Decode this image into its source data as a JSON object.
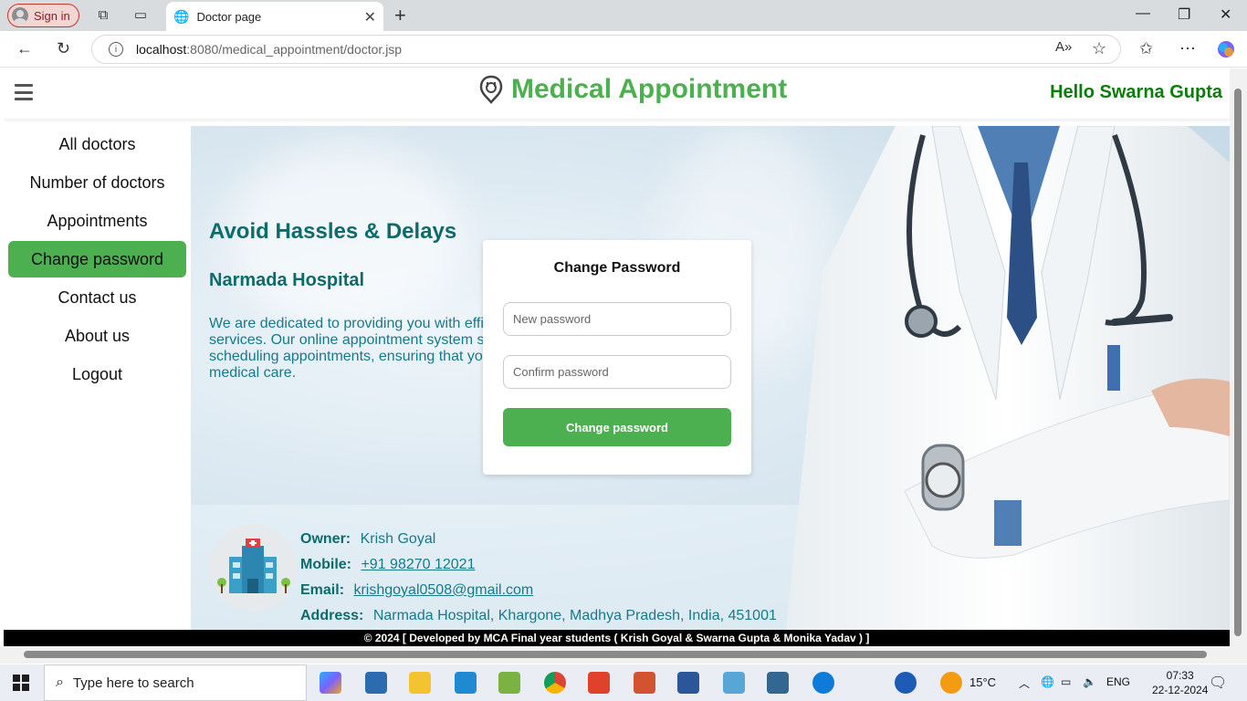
{
  "browser": {
    "signin_label": "Sign in",
    "tab_title": "Doctor page",
    "url_host": "localhost",
    "url_path": ":8080/medical_appointment/doctor.jsp"
  },
  "header": {
    "title": "Medical Appointment",
    "greeting": "Hello Swarna Gupta"
  },
  "sidebar": {
    "items": [
      {
        "label": "All doctors"
      },
      {
        "label": "Number of doctors"
      },
      {
        "label": "Appointments"
      },
      {
        "label": "Change password",
        "active": true
      },
      {
        "label": "Contact us"
      },
      {
        "label": "About us"
      },
      {
        "label": "Logout"
      }
    ]
  },
  "hero": {
    "heading": "Avoid Hassles & Delays",
    "hospital": "Narmada Hospital",
    "description_lines": [
      "We are dedicated to providing you with effi",
      "services. Our online appointment system s",
      "scheduling appointments, ensuring that yo",
      "medical care."
    ]
  },
  "change_password": {
    "title": "Change Password",
    "new_placeholder": "New password",
    "confirm_placeholder": "Confirm password",
    "submit_label": "Change password"
  },
  "contact": {
    "owner_label": "Owner:",
    "owner_value": "Krish Goyal",
    "mobile_label": "Mobile:",
    "mobile_value": "+91 98270 12021",
    "email_label": "Email:",
    "email_value": "krishgoyal0508@gmail.com",
    "address_label": "Address:",
    "address_value": "Narmada Hospital, Khargone, Madhya Pradesh, India, 451001"
  },
  "footer": {
    "copyright": "© 2024 [ Developed by MCA Final year students ( Krish Goyal & Swarna Gupta & Monika Yadav ) ]"
  },
  "taskbar": {
    "search_placeholder": "Type here to search",
    "weather": "15°C",
    "language": "ENG",
    "time": "07:33",
    "date": "22-12-2024"
  },
  "colors": {
    "accent": "#4caf50",
    "greeting": "#0b7d0b",
    "teal": "#0d6b6b"
  }
}
